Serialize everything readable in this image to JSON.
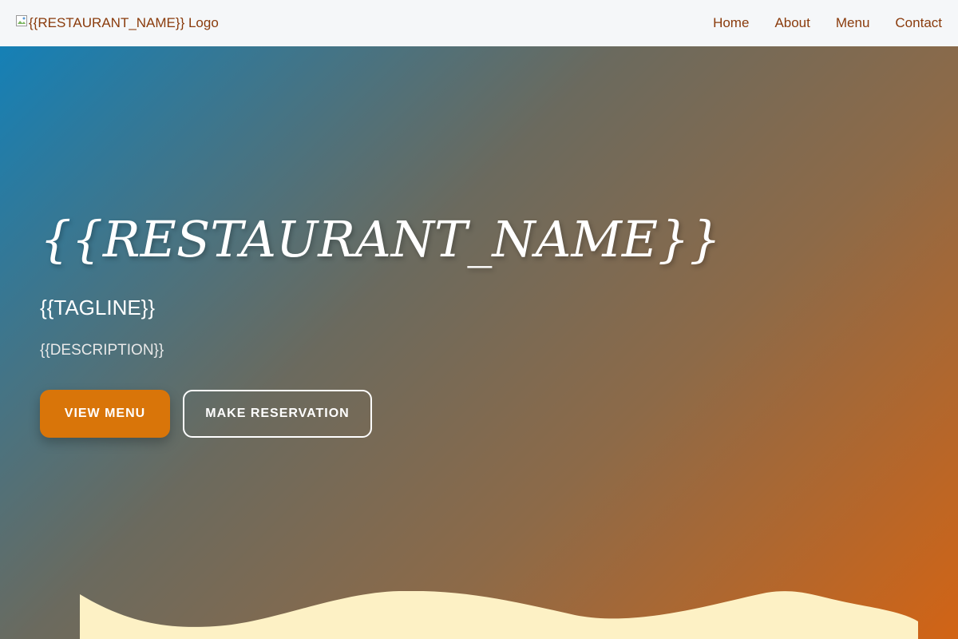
{
  "header": {
    "logo_text": "{{RESTAURANT_NAME}} Logo",
    "nav": [
      "Home",
      "About",
      "Menu",
      "Contact"
    ]
  },
  "hero": {
    "title": "{{RESTAURANT_NAME}}",
    "tagline": "{{TAGLINE}}",
    "description": "{{DESCRIPTION}}",
    "primary_button": "VIEW MENU",
    "secondary_button": "MAKE RESERVATION"
  },
  "colors": {
    "nav_text": "#8a3b0c",
    "primary_button": "#d97509",
    "wave": "#fdf1c5",
    "gradient_start": "#1580b6",
    "gradient_end": "#d26415"
  }
}
